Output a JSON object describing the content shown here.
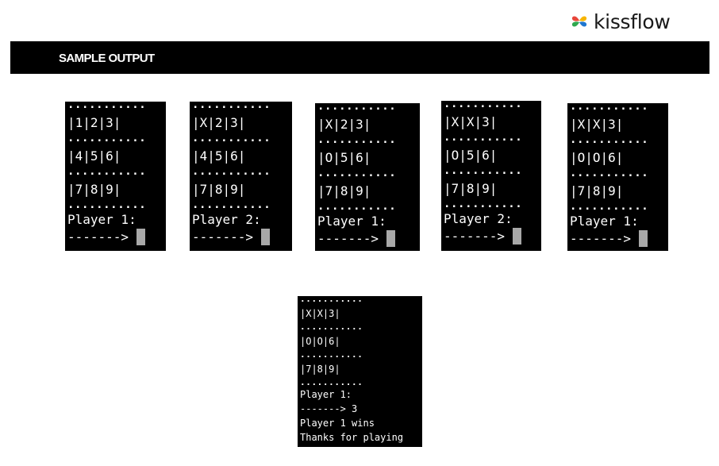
{
  "brand": {
    "name": "kissflow",
    "logo_colors": [
      "#E8463A",
      "#F7B500",
      "#2FA84F",
      "#1F77D0"
    ]
  },
  "banner": {
    "title": "SAMPLE OUTPUT"
  },
  "dots": "...........",
  "prompt_arrow": "-------> ",
  "panels": [
    {
      "rows": [
        "|1|2|3|",
        "|4|5|6|",
        "|7|8|9|"
      ],
      "player": "Player 1:"
    },
    {
      "rows": [
        "|X|2|3|",
        "|4|5|6|",
        "|7|8|9|"
      ],
      "player": "Player 2:"
    },
    {
      "rows": [
        "|X|2|3|",
        "|O|5|6|",
        "|7|8|9|"
      ],
      "player": "Player 1:"
    },
    {
      "rows": [
        "|X|X|3|",
        "|O|5|6|",
        "|7|8|9|"
      ],
      "player": "Player 2:"
    },
    {
      "rows": [
        "|X|X|3|",
        "|O|O|6|",
        "|7|8|9|"
      ],
      "player": "Player 1:"
    }
  ],
  "final": {
    "rows": [
      "|X|X|3|",
      "|O|O|6|",
      "|7|8|9|"
    ],
    "player": "Player 1:",
    "prompt": "-------> 3",
    "result": "Player 1 wins",
    "thanks": "Thanks for playing"
  }
}
